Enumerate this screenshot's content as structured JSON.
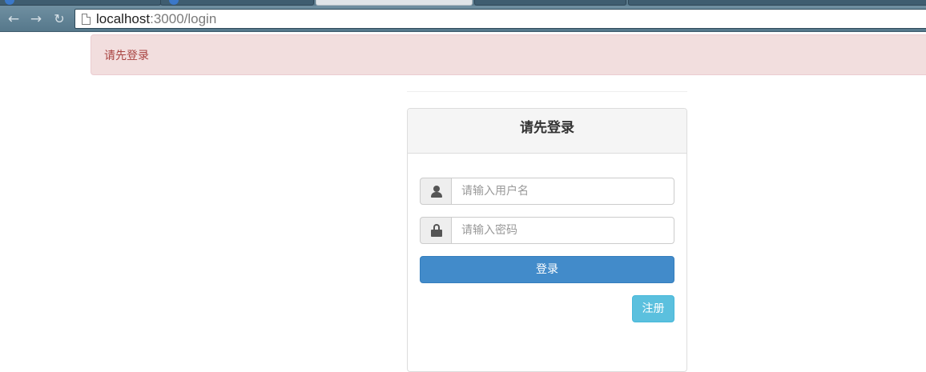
{
  "browser": {
    "url_host": "localhost",
    "url_rest": ":3000/login"
  },
  "alert": {
    "message": "请先登录"
  },
  "login_panel": {
    "title": "请先登录",
    "username_placeholder": "请输入用户名",
    "password_placeholder": "请输入密码",
    "login_button": "登录",
    "register_button": "注册"
  },
  "colors": {
    "alert_bg": "#f2dede",
    "alert_text": "#a94442",
    "primary": "#428bca",
    "info": "#5bc0de"
  },
  "icons": {
    "username": "user-icon",
    "password": "lock-icon"
  }
}
